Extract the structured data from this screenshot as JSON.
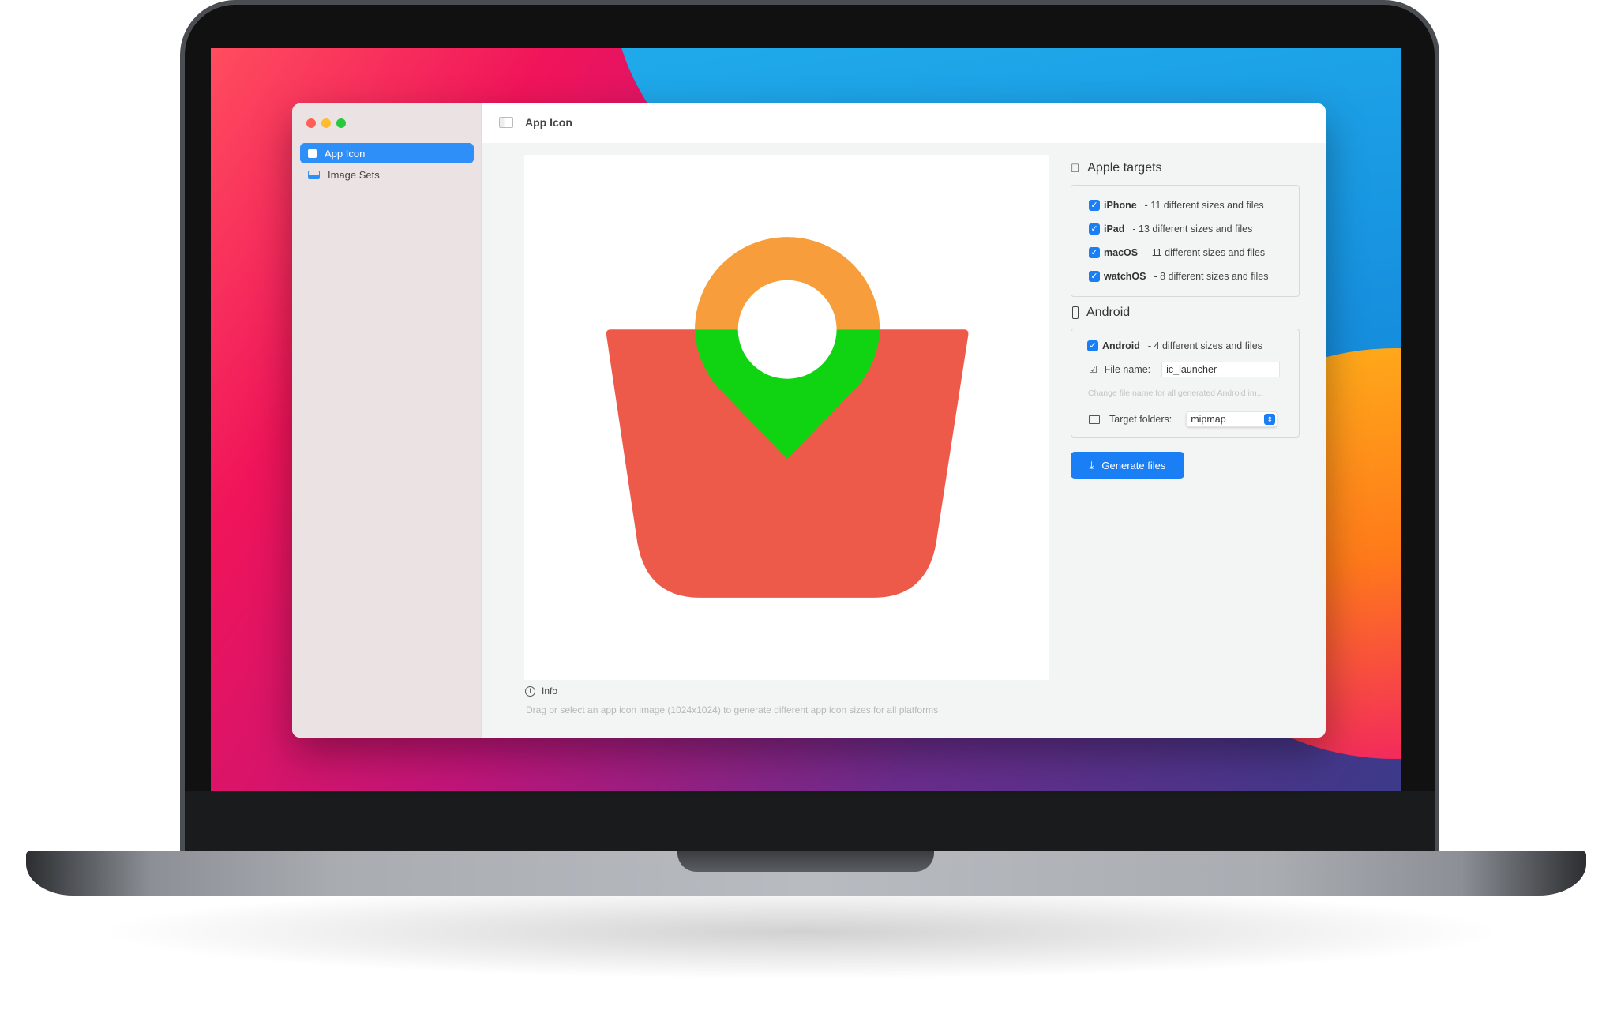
{
  "window": {
    "title": "App Icon"
  },
  "sidebar": {
    "items": [
      {
        "label": "App Icon",
        "icon": "app-icon",
        "active": true
      },
      {
        "label": "Image Sets",
        "icon": "image-sets-icon",
        "active": false
      }
    ]
  },
  "apple": {
    "title": "Apple targets",
    "targets": [
      {
        "name": "iPhone",
        "desc": "- 11 different sizes and files",
        "checked": true
      },
      {
        "name": "iPad",
        "desc": "- 13 different sizes and files",
        "checked": true
      },
      {
        "name": "macOS",
        "desc": "- 11 different sizes and files",
        "checked": true
      },
      {
        "name": "watchOS",
        "desc": "- 8 different sizes and files",
        "checked": true
      }
    ]
  },
  "android": {
    "title": "Android",
    "target": {
      "name": "Android",
      "desc": "- 4 different sizes and files",
      "checked": true
    },
    "file_name_label": "File name:",
    "file_name_value": "ic_launcher",
    "hint": "Change file name for all generated Android im...",
    "folder_label": "Target folders:",
    "folder_value": "mipmap"
  },
  "generate_label": "Generate files",
  "info": {
    "title": "Info",
    "text": "Drag or select an app icon image (1024x1024) to generate different app icon sizes for all platforms"
  },
  "colors": {
    "accent": "#1a7ff5",
    "basket": "#ee5a4a",
    "ring": "#f79d3b",
    "pin": "#10d412"
  }
}
